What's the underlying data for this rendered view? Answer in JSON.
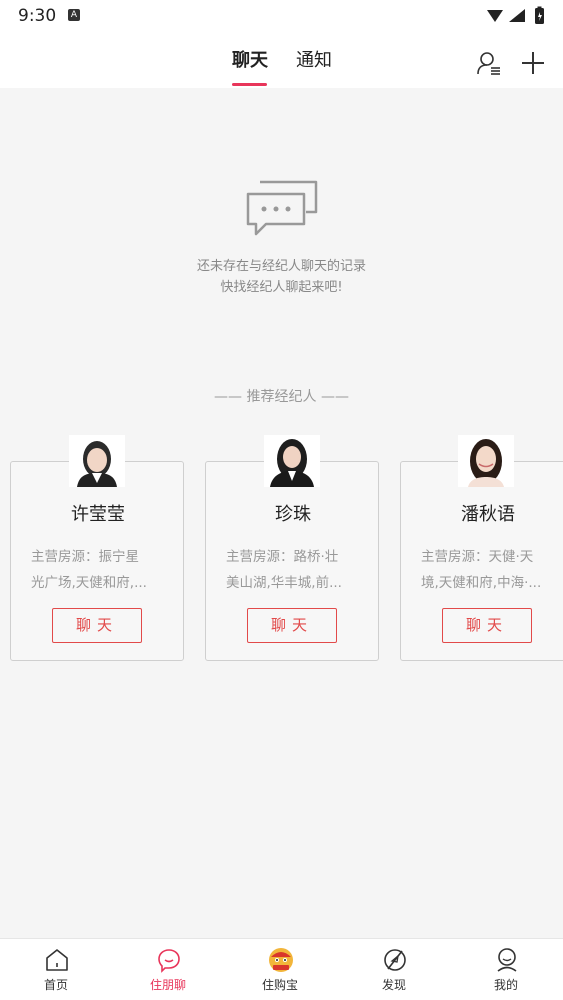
{
  "status_bar": {
    "time": "9:30",
    "notification_badge": "A"
  },
  "header": {
    "tabs": [
      {
        "label": "聊天",
        "active": true
      },
      {
        "label": "通知",
        "active": false
      }
    ],
    "accent_color": "#e8355a",
    "icons": [
      "contacts-icon",
      "plus-icon"
    ]
  },
  "empty_state": {
    "icon": "chat-bubbles-icon",
    "line1": "还未存在与经纪人聊天的记录",
    "line2": "快找经纪人聊起来吧!"
  },
  "recommend": {
    "title": "—— 推荐经纪人 ——",
    "agents": [
      {
        "name": "许莹莹",
        "desc_line1": "主营房源：振宁星",
        "desc_line2": "光广场,天健和府,...",
        "button": "聊天"
      },
      {
        "name": "珍珠",
        "desc_line1": "主营房源：路桥·壮",
        "desc_line2": "美山湖,华丰城,前...",
        "button": "聊天"
      },
      {
        "name": "潘秋语",
        "desc_line1": "主营房源：天健·天",
        "desc_line2": "境,天健和府,中海·...",
        "button": "聊天"
      }
    ]
  },
  "bottom_nav": {
    "items": [
      {
        "label": "首页",
        "icon": "home-icon",
        "active": false
      },
      {
        "label": "住朋聊",
        "icon": "chat-icon",
        "active": true
      },
      {
        "label": "住购宝",
        "icon": "shop-mascot-icon",
        "active": false
      },
      {
        "label": "发现",
        "icon": "compass-icon",
        "active": false
      },
      {
        "label": "我的",
        "icon": "profile-icon",
        "active": false
      }
    ]
  }
}
